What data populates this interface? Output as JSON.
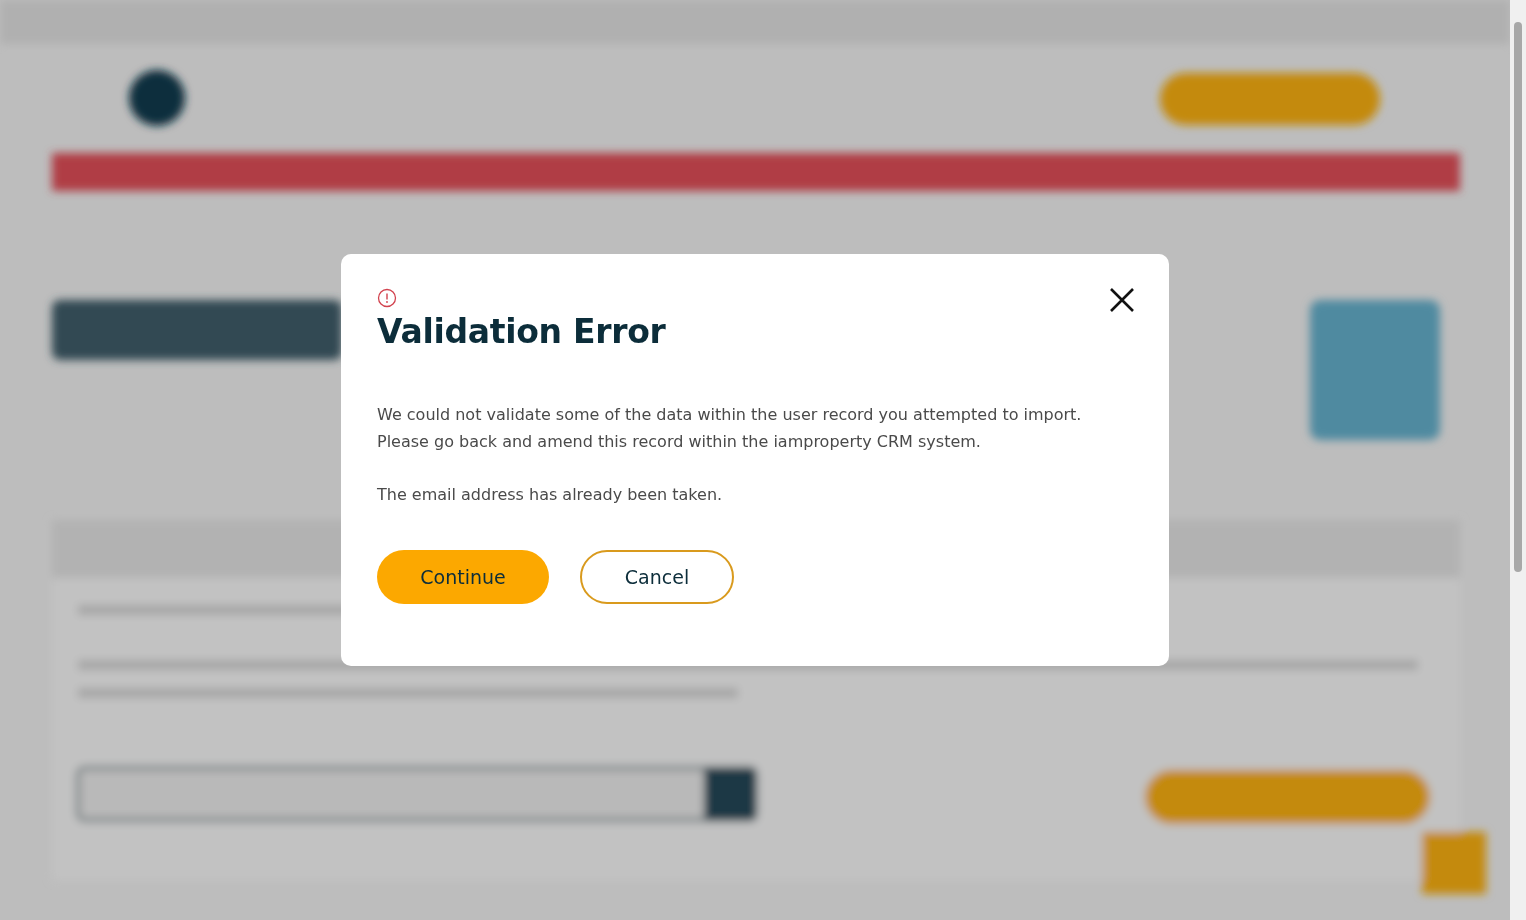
{
  "dialog": {
    "title": "Validation Error",
    "paragraphs": [
      "We could not validate some of the data within the user record you attempted to import. Please go back and amend this record within the iamproperty CRM system.",
      "The email address has already been taken."
    ],
    "buttons": [
      {
        "label": "Continue",
        "kind": "primary"
      },
      {
        "label": "Cancel",
        "kind": "secondary"
      }
    ]
  }
}
